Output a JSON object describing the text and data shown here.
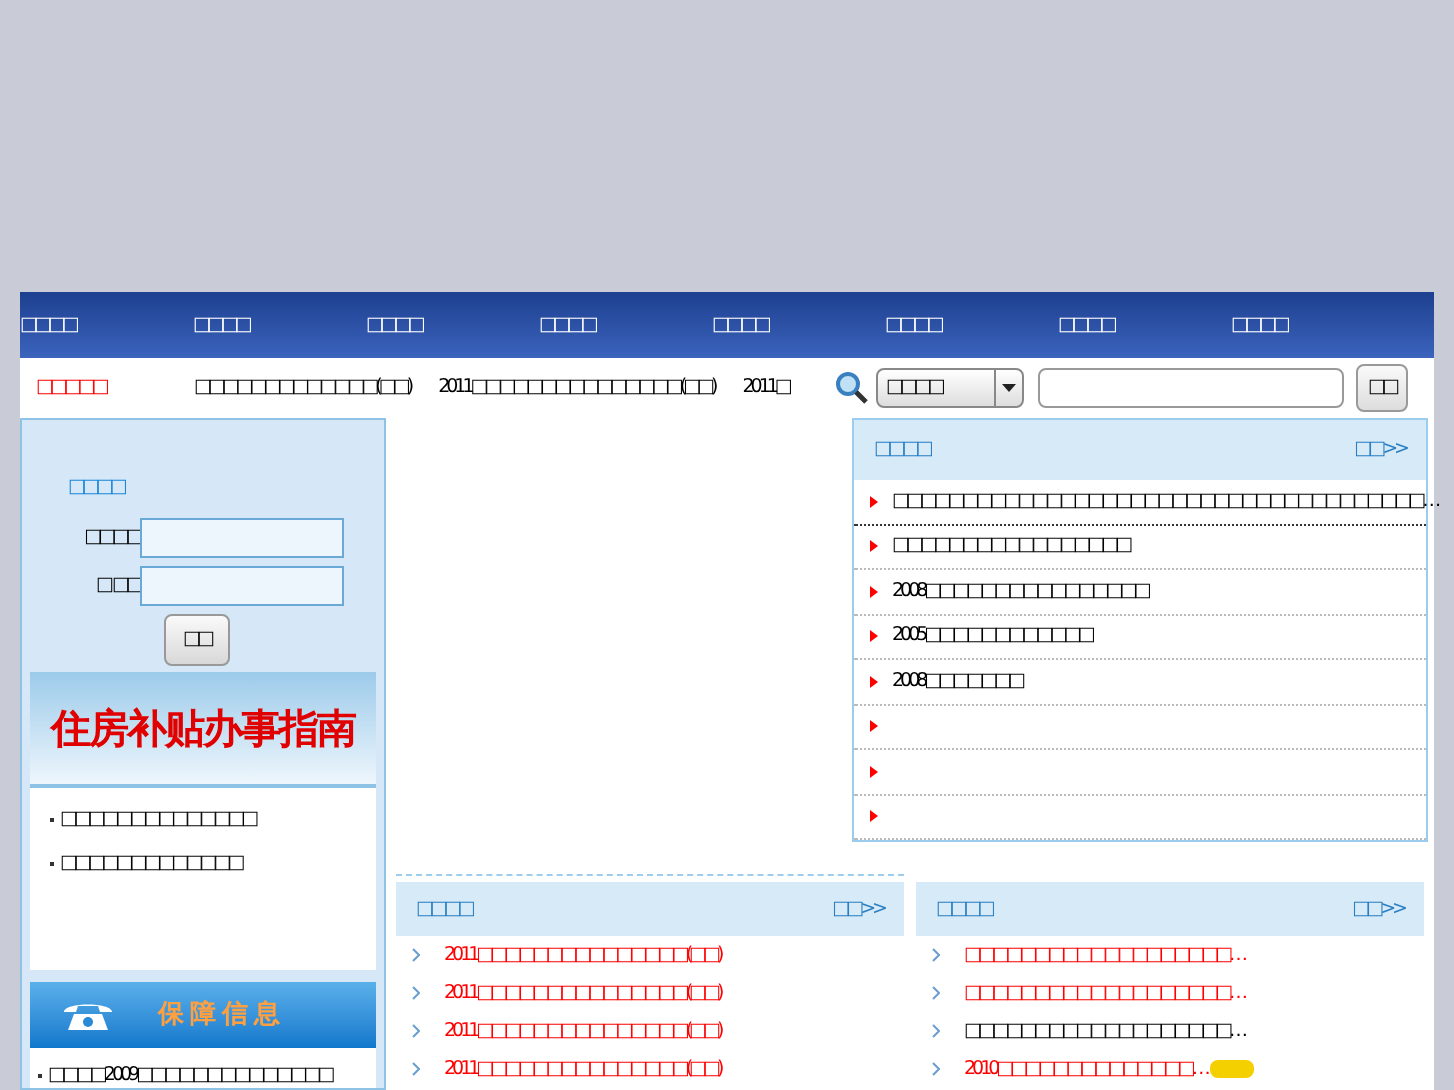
{
  "nav": {
    "items": [
      "□□□□",
      "□□□□",
      "□□□□",
      "□□□□",
      "□□□□",
      "□□□□",
      "□□□□",
      "□□□□"
    ]
  },
  "ticker": {
    "label": "□□□□□",
    "items": [
      "□□□□□□□□□□□□□(□□)",
      "2011□□□□□□□□□□□□□□□(□□)",
      "2011□"
    ]
  },
  "search": {
    "category": "□□□□",
    "button": "□□"
  },
  "login": {
    "title": "□□□□",
    "username_label": "□□□□",
    "password_label": "□ □□",
    "button": "□□"
  },
  "guide": {
    "banner": "住房补贴办事指南",
    "items": [
      "□□□□□□□□□□□□□□",
      "□□□□□□□□□□□□□"
    ]
  },
  "info": {
    "banner": "保障信息",
    "items": [
      "□□□□2009□□□□□□□□□□□□□□"
    ]
  },
  "notice": {
    "title": "□□□□",
    "more": "□□>>",
    "items": [
      {
        "kind": "link",
        "text": "□□□□□□□□□□□□□□□□□□□□□□□□□□□□□□□□□□□□□□…"
      },
      {
        "kind": "link",
        "text": "□□□□□□□□□□□□□□□□□"
      },
      {
        "kind": "link",
        "text": "2008□□□□□□□□□□□□□□□□"
      },
      {
        "kind": "link",
        "text": "2005□□□□□□□□□□□□"
      },
      {
        "kind": "link",
        "text": "2008□□□□□□□"
      },
      {
        "kind": "blank"
      },
      {
        "kind": "blank"
      },
      {
        "kind": "blank"
      }
    ]
  },
  "news_left": {
    "title": "□□□□",
    "more": "□□>>",
    "items": [
      {
        "text": "2011□□□□□□□□□□□□□□□(□□)",
        "highlight": true,
        "new": false
      },
      {
        "text": "2011□□□□□□□□□□□□□□□(□□)",
        "highlight": true,
        "new": false
      },
      {
        "text": "2011□□□□□□□□□□□□□□□(□□)",
        "highlight": true,
        "new": false
      },
      {
        "text": "2011□□□□□□□□□□□□□□□(□□)",
        "highlight": true,
        "new": false
      }
    ]
  },
  "news_right": {
    "title": "□□□□",
    "more": "□□>>",
    "items": [
      {
        "text": "□□□□□□□□□□□□□□□□□□□…",
        "highlight": true,
        "new": false
      },
      {
        "text": "□□□□□□□□□□□□□□□□□□□…",
        "highlight": true,
        "new": false
      },
      {
        "text": "□□□□□□□□□□□□□□□□□□□…",
        "highlight": false,
        "new": false
      },
      {
        "text": "2010□□□□□□□□□□□□□□…",
        "highlight": true,
        "new": true
      }
    ]
  }
}
